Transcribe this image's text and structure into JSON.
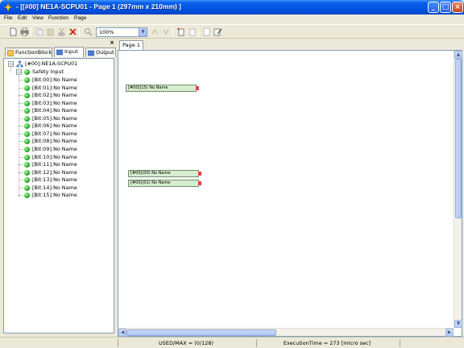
{
  "window": {
    "title": "- [[#00] NE1A-SCPU01 - Page 1 (297mm x 210mm) ]"
  },
  "menu": {
    "items": [
      "File",
      "Edit",
      "View",
      "Function",
      "Page"
    ]
  },
  "toolbar": {
    "zoom": "100%"
  },
  "left_panel": {
    "close_label": "×",
    "tabs": [
      "FunctionBlock",
      "Input",
      "Output"
    ],
    "active_tab": "Input",
    "tree": {
      "root": "[#00]:NE1A-SCPU01",
      "group": "Safety Input",
      "items": [
        "[Bit:00]:No Name",
        "[Bit:01]:No Name",
        "[Bit:02]:No Name",
        "[Bit:03]:No Name",
        "[Bit:04]:No Name",
        "[Bit:05]:No Name",
        "[Bit:06]:No Name",
        "[Bit:07]:No Name",
        "[Bit:08]:No Name",
        "[Bit:09]:No Name",
        "[Bit:10]:No Name",
        "[Bit:11]:No Name",
        "[Bit:12]:No Name",
        "[Bit:13]:No Name",
        "[Bit:14]:No Name",
        "[Bit:15]:No Name"
      ]
    }
  },
  "editor": {
    "page_tab": "Page 1",
    "blocks": [
      "[#00](15) No Name",
      "[#00](00) No Name",
      "[#00](01) No Name"
    ]
  },
  "status": {
    "used": "USED/MAX = (0/128)",
    "exec": "ExecutionTime = 273 [micro sec]"
  },
  "colors": {
    "titlebar": "#0055e5",
    "block_fill": "#d8ecd0",
    "port": "#e8404a",
    "tree_status": "#1c9a1c"
  }
}
